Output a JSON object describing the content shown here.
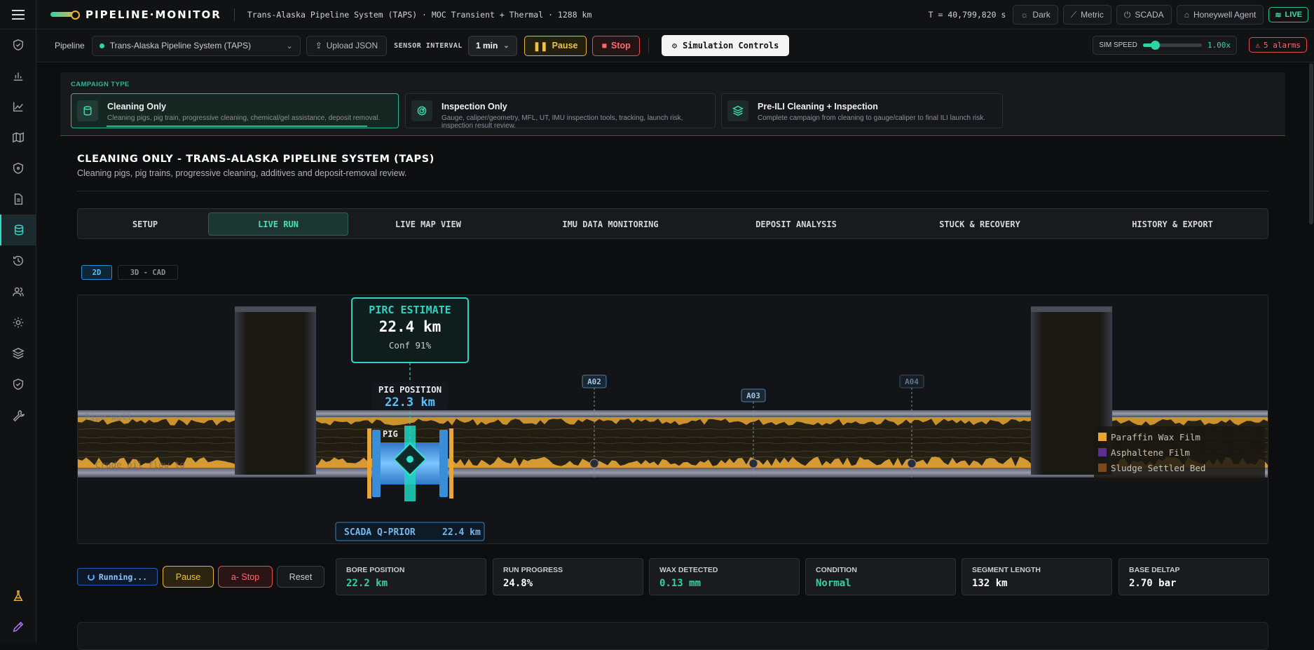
{
  "app": {
    "logo_text": "PIPELINE·MONITOR",
    "subtitle": "Trans-Alaska Pipeline System (TAPS) · MOC Transient + Thermal · 1288 km",
    "clock": "T = 40,799,820 s",
    "theme_label": "Dark",
    "units_label": "Metric",
    "scada_label": "SCADA",
    "agent_label": "Honeywell Agent",
    "live_label": "LIVE"
  },
  "toolbar": {
    "pipeline_label": "Pipeline",
    "pipeline_value": "Trans-Alaska Pipeline System (TAPS)",
    "upload_label": "Upload JSON",
    "sensor_interval_label": "SENSOR INTERVAL",
    "sensor_interval_value": "1 min",
    "pause_label": "Pause",
    "stop_label": "Stop",
    "sim_controls_label": "Simulation Controls",
    "sim_speed_label": "SIM SPEED",
    "sim_speed_value": "1.00x",
    "sim_speed_level": 0.2,
    "alarms_label": "5 alarms"
  },
  "campaign": {
    "heading": "CAMPAIGN TYPE",
    "cards": [
      {
        "title": "Cleaning Only",
        "desc": "Cleaning pigs, pig train, progressive cleaning, chemical/gel assistance, deposit removal."
      },
      {
        "title": "Inspection Only",
        "desc": "Gauge, caliper/geometry, MFL, UT, IMU inspection tools, tracking, launch risk, inspection result review."
      },
      {
        "title": "Pre-ILI Cleaning + Inspection",
        "desc": "Complete campaign from cleaning to gauge/caliper to final ILI launch risk."
      }
    ]
  },
  "main": {
    "title": "CLEANING ONLY - TRANS-ALASKA PIPELINE SYSTEM (TAPS)",
    "subtitle": "Cleaning pigs, pig trains, progressive cleaning, additives and deposit-removal review.",
    "tabs": [
      "SETUP",
      "LIVE RUN",
      "LIVE MAP VIEW",
      "IMU DATA MONITORING",
      "DEPOSIT ANALYSIS",
      "STUCK & RECOVERY",
      "HISTORY & EXPORT"
    ],
    "view_2d": "2D",
    "view_3d": "3D - CAD"
  },
  "viz": {
    "pirc_title": "PIRC ESTIMATE",
    "pirc_value": "22.4 km",
    "pirc_conf": "Conf 91%",
    "pig_pos_label": "PIG POSITION",
    "pig_pos_value": "22.3 km",
    "pig_label": "PIG",
    "markers": [
      "A02",
      "A03",
      "A04"
    ],
    "pipe_wall_label": "Pipe wall",
    "flow_label": "Crude oil flow to",
    "scada_label": "SCADA Q-PRIOR",
    "scada_value": "22.4 km",
    "legend": [
      "Paraffin Wax Film",
      "Asphaltene Film",
      "Sludge Settled Bed"
    ],
    "colors": {
      "wax": "#e8a735",
      "asphaltene": "#5b2f8c",
      "sludge": "#7a4a1f",
      "pirc": "#2fd3c0",
      "pig": "#3a8ed8"
    }
  },
  "controls": {
    "running_label": "Running...",
    "pause_label": "Pause",
    "stop_label": "a- Stop",
    "reset_label": "Reset"
  },
  "stats": [
    {
      "label": "BORE POSITION",
      "value": "22.2 km",
      "color": "#2fd3a8"
    },
    {
      "label": "RUN PROGRESS",
      "value": "24.8%",
      "color": "#ffffff"
    },
    {
      "label": "WAX DETECTED",
      "value": "0.13 mm",
      "color": "#2fd3a8"
    },
    {
      "label": "CONDITION",
      "value": "Normal",
      "color": "#2fd3a8"
    },
    {
      "label": "SEGMENT LENGTH",
      "value": "132 km",
      "color": "#ffffff"
    },
    {
      "label": "BASE DELTAP",
      "value": "2.70 bar",
      "color": "#ffffff"
    }
  ]
}
